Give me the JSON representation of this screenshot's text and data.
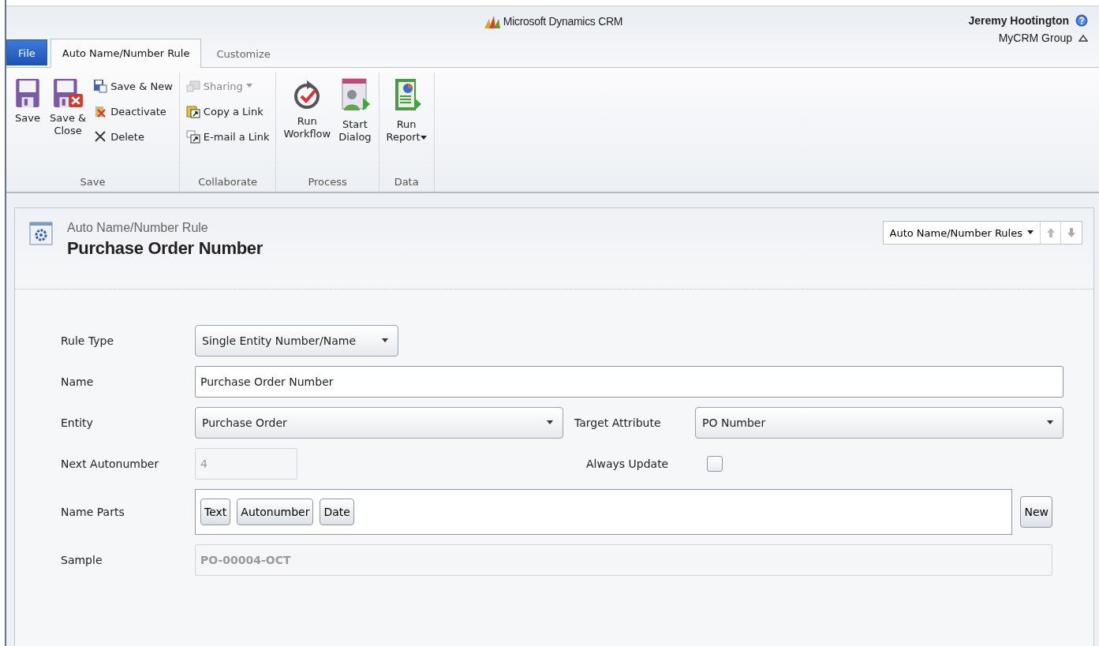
{
  "header": {
    "product": "Microsoft Dynamics CRM",
    "user": "Jeremy Hootington",
    "organization": "MyCRM Group"
  },
  "tabs": [
    {
      "label": "File",
      "kind": "file",
      "selected": false
    },
    {
      "label": "Auto Name/Number Rule",
      "kind": "tab",
      "selected": true
    },
    {
      "label": "Customize",
      "kind": "tab",
      "selected": false
    }
  ],
  "ribbon_groups": [
    {
      "label": "Save",
      "items": [
        {
          "kind": "large",
          "label": "Save",
          "disabled": false,
          "dropdown": false
        },
        {
          "kind": "large",
          "label": "Save &\nClose",
          "disabled": false,
          "dropdown": false
        },
        {
          "kind": "small",
          "label": "Save & New",
          "disabled": false,
          "dropdown": false
        },
        {
          "kind": "small",
          "label": "Deactivate",
          "disabled": false,
          "dropdown": false
        },
        {
          "kind": "small",
          "label": "Delete",
          "disabled": false,
          "dropdown": false
        }
      ]
    },
    {
      "label": "Collaborate",
      "items": [
        {
          "kind": "small",
          "label": "Sharing",
          "disabled": true,
          "dropdown": true
        },
        {
          "kind": "small",
          "label": "Copy a Link",
          "disabled": false,
          "dropdown": false
        },
        {
          "kind": "small",
          "label": "E-mail a Link",
          "disabled": false,
          "dropdown": false
        }
      ]
    },
    {
      "label": "Process",
      "items": [
        {
          "kind": "large",
          "label": "Run\nWorkflow",
          "disabled": false,
          "dropdown": false
        },
        {
          "kind": "large",
          "label": "Start\nDialog",
          "disabled": false,
          "dropdown": false
        }
      ]
    },
    {
      "label": "Data",
      "items": [
        {
          "kind": "large",
          "label": "Run\nReport",
          "disabled": false,
          "dropdown": true
        }
      ]
    }
  ],
  "record": {
    "entity_label": "Auto Name/Number Rule",
    "title": "Purchase Order Number",
    "navigator": "Auto Name/Number Rules"
  },
  "form": {
    "rule_type": {
      "label": "Rule Type",
      "value": "Single Entity Number/Name"
    },
    "name": {
      "label": "Name",
      "value": "Purchase Order Number"
    },
    "entity": {
      "label": "Entity",
      "value": "Purchase Order"
    },
    "target_attribute": {
      "label": "Target Attribute",
      "value": "PO Number"
    },
    "next_autonumber": {
      "label": "Next Autonumber",
      "value": "4",
      "disabled": true
    },
    "always_update": {
      "label": "Always Update",
      "checked": false
    },
    "name_parts": {
      "label": "Name Parts",
      "parts": [
        "Text",
        "Autonumber",
        "Date"
      ],
      "button": "New"
    },
    "sample": {
      "label": "Sample",
      "value": "PO-00004-OCT"
    }
  }
}
